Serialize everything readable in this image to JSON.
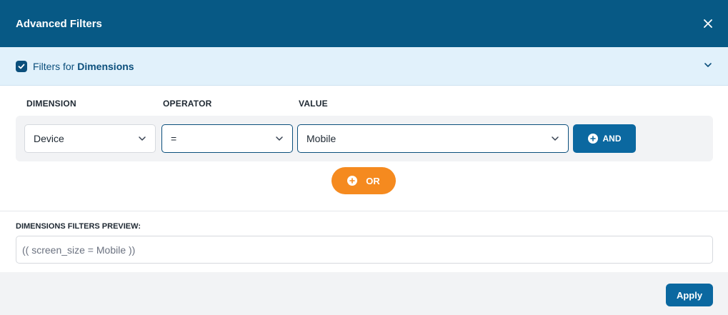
{
  "dialog": {
    "title": "Advanced Filters",
    "close_icon": "close-icon"
  },
  "section": {
    "label_prefix": "Filters for ",
    "label_bold": "Dimensions",
    "checked": true,
    "expand_icon": "chevron-down-icon"
  },
  "columns": {
    "dimension": "DIMENSION",
    "operator": "OPERATOR",
    "value": "VALUE"
  },
  "filter_row": {
    "dimension": "Device",
    "operator": "=",
    "value": "Mobile"
  },
  "buttons": {
    "and_label": "AND",
    "or_label": "OR",
    "apply_label": "Apply"
  },
  "preview": {
    "label": "DIMENSIONS FILTERS PREVIEW:",
    "value": "(( screen_size = Mobile ))"
  },
  "colors": {
    "header": "#075985",
    "section_bg": "#e1f1fb",
    "primary": "#0b68a0",
    "or_button": "#f58a1f"
  }
}
